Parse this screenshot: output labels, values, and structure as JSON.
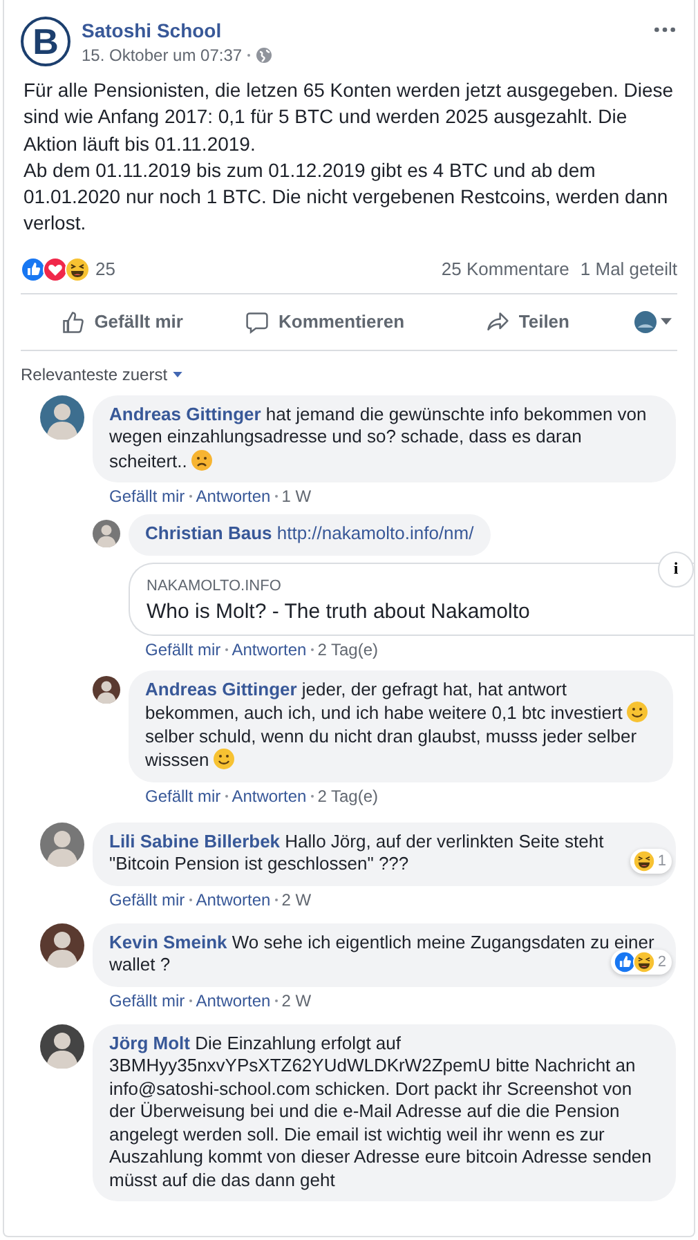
{
  "post": {
    "author": "Satoshi School",
    "logo_letter": "B",
    "time": "15. Oktober um 07:37",
    "paragraphs": [
      "Für alle Pensionisten, die letzen 65 Konten werden jetzt ausgegeben. Diese sind wie Anfang 2017: 0,1 für 5 BTC und werden 2025 ausgezahlt. Die Aktion läuft bis 01.11.2019.",
      "Ab dem 01.11.2019 bis zum 01.12.2019 gibt es 4 BTC und ab dem 01.01.2020 nur noch 1 BTC. Die nicht vergebenen Restcoins, werden dann verlost."
    ],
    "reactions": [
      {
        "kind": "like"
      },
      {
        "kind": "love"
      },
      {
        "kind": "haha"
      }
    ],
    "reaction_count": "25",
    "comments_count": "25 Kommentare",
    "shares": "1 Mal geteilt",
    "actions": [
      {
        "label": "Gefällt mir",
        "kind": "like"
      },
      {
        "label": "Kommentieren",
        "kind": "comment"
      },
      {
        "label": "Teilen",
        "kind": "share"
      }
    ]
  },
  "sort": "Relevanteste zuerst",
  "comments": [
    {
      "author": "Andreas Gittinger",
      "parts": [
        {
          "kind": "text",
          "text": "hat jemand die gewünschte info bekommen von wegen einzahlungsadresse und so? schade, dass es daran scheitert.."
        },
        {
          "kind": "sad"
        }
      ],
      "meta": [
        "Gefällt mir",
        "Antworten"
      ],
      "time": "1 W",
      "children": [
        {
          "author": "Christian Baus",
          "parts": [
            {
              "kind": "link",
              "text": "http://nakamolto.info/nm/"
            }
          ],
          "preview": {
            "domain": "NAKAMOLTO.INFO",
            "title": "Who is Molt? - The truth about Nakamolto",
            "info": "i"
          },
          "meta": [
            "Gefällt mir",
            "Antworten"
          ],
          "time": "2 Tag(e)"
        },
        {
          "author": "Andreas Gittinger",
          "parts": [
            {
              "kind": "text",
              "text": "jeder, der gefragt hat, hat antwort bekommen, auch ich, und ich habe weitere 0,1 btc investiert"
            },
            {
              "kind": "smile"
            },
            {
              "kind": "text",
              "text": "selber schuld, wenn du nicht dran glaubst, musss jeder selber wisssen"
            },
            {
              "kind": "smile"
            }
          ],
          "meta": [
            "Gefällt mir",
            "Antworten"
          ],
          "time": "2 Tag(e)"
        }
      ]
    },
    {
      "author": "Lili Sabine Billerbek",
      "parts": [
        {
          "kind": "text",
          "text": "Hallo Jörg, auf der verlinkten Seite steht \"Bitcoin Pension ist geschlossen\" ???"
        }
      ],
      "meta": [
        "Gefällt mir",
        "Antworten"
      ],
      "time": "2 W",
      "reactions": [
        {
          "kind": "haha"
        }
      ],
      "reaction_count": "1"
    },
    {
      "author": "Kevin Smeink",
      "parts": [
        {
          "kind": "text",
          "text": "Wo sehe ich eigentlich meine Zugangsdaten zu einer wallet ?"
        }
      ],
      "meta": [
        "Gefällt mir",
        "Antworten"
      ],
      "time": "2 W",
      "reactions": [
        {
          "kind": "like"
        },
        {
          "kind": "haha"
        }
      ],
      "reaction_count": "2"
    },
    {
      "author": "Jörg Molt",
      "parts": [
        {
          "kind": "text",
          "text": "Die Einzahlung erfolgt auf 3BMHyy35nxvYPsXTZ62YUdWLDKrW2ZpemU bitte Nachricht an info@satoshi-school.com schicken. Dort packt ihr Screenshot von der Überweisung bei und die e-Mail Adresse auf die die Pension angelegt werden soll. Die email ist wichtig weil ihr wenn es zur Auszahlung kommt von dieser Adresse eure bitcoin Adresse senden müsst auf die das dann geht"
        }
      ]
    }
  ]
}
